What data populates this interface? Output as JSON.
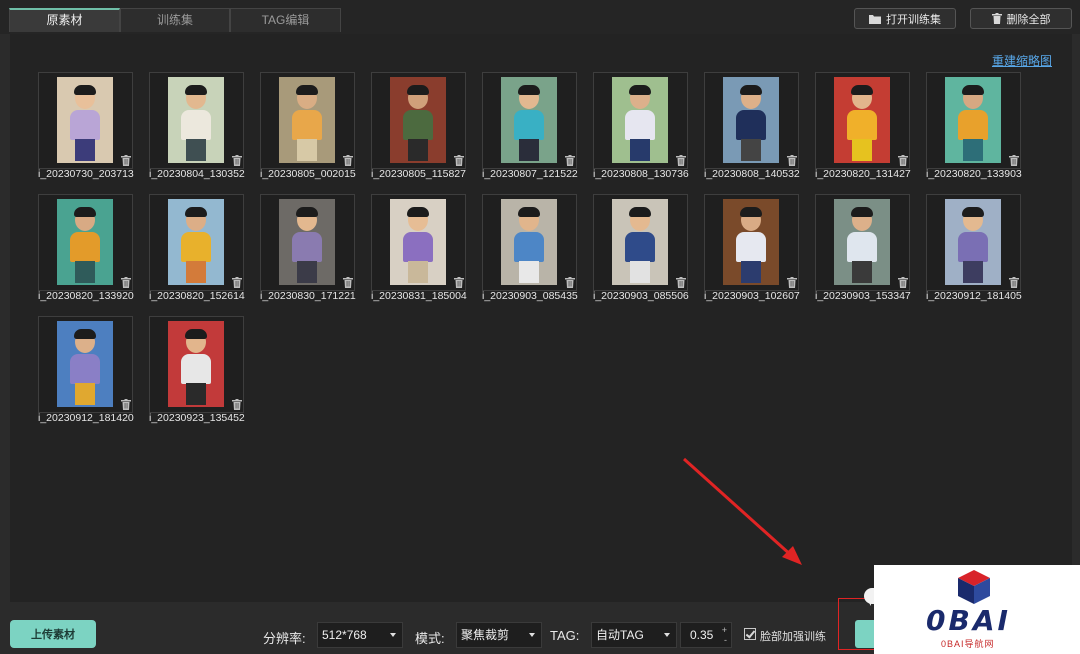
{
  "tabs": [
    {
      "label": "原素材",
      "active": true
    },
    {
      "label": "训练集",
      "active": false
    },
    {
      "label": "TAG编辑",
      "active": false
    }
  ],
  "toolbar": {
    "open_training_set": "打开训练集",
    "delete_all": "删除全部"
  },
  "rebuild_thumbnails": "重建缩略图",
  "images": [
    {
      "name": "i_20230730_203713",
      "bg": "#d9c9b0",
      "shirt": "#b9a5d6",
      "pants": "#3c3c7a",
      "skin": "#e8c09a"
    },
    {
      "name": "i_20230804_130352",
      "bg": "#c8d3b9",
      "shirt": "#ece8dd",
      "pants": "#3f4f52",
      "skin": "#e2b88f"
    },
    {
      "name": "i_20230805_002015",
      "bg": "#a89a7a",
      "shirt": "#e8a74a",
      "pants": "#d7c9a6",
      "skin": "#d9ad84"
    },
    {
      "name": "i_20230805_115827",
      "bg": "#8a3d2d",
      "shirt": "#4c6a3f",
      "pants": "#2a2a2a",
      "skin": "#d0a07a"
    },
    {
      "name": "i_20230807_121522",
      "bg": "#7aa38a",
      "shirt": "#39b0c4",
      "pants": "#2a2d3a",
      "skin": "#e2b890"
    },
    {
      "name": "i_20230808_130736",
      "bg": "#9fbf8f",
      "shirt": "#e6e6f0",
      "pants": "#273a6b",
      "skin": "#dcb08b"
    },
    {
      "name": "i_20230808_140532",
      "bg": "#7a9ab5",
      "shirt": "#1f2f5a",
      "pants": "#444",
      "skin": "#ddb089"
    },
    {
      "name": "i_20230820_131427",
      "bg": "#c43d33",
      "shirt": "#f0b02a",
      "pants": "#e6c21f",
      "skin": "#e2b58c"
    },
    {
      "name": "i_20230820_133903",
      "bg": "#5fb59f",
      "shirt": "#e8a12c",
      "pants": "#2d6e78",
      "skin": "#d6a882"
    },
    {
      "name": "i_20230820_133920",
      "bg": "#4aa391",
      "shirt": "#e39b2a",
      "pants": "#2f5b5a",
      "skin": "#d8aa84"
    },
    {
      "name": "i_20230820_152614",
      "bg": "#93b8d0",
      "shirt": "#e8b12c",
      "pants": "#d37b3a",
      "skin": "#dcae87"
    },
    {
      "name": "i_20230830_171221",
      "bg": "#6d6a66",
      "shirt": "#8a7bb0",
      "pants": "#3b3b48",
      "skin": "#e3b88f"
    },
    {
      "name": "i_20230831_185004",
      "bg": "#d8d0c4",
      "shirt": "#8b6fc0",
      "pants": "#c9b89a",
      "skin": "#e6bd95"
    },
    {
      "name": "i_20230903_085435",
      "bg": "#b9b4a8",
      "shirt": "#4d86c6",
      "pants": "#e8e8e8",
      "skin": "#e1b58c"
    },
    {
      "name": "i_20230903_085506",
      "bg": "#c9c4b8",
      "shirt": "#2f4b8a",
      "pants": "#e2e2e2",
      "skin": "#e4b990"
    },
    {
      "name": "i_20230903_102607",
      "bg": "#7a4a2a",
      "shirt": "#e6e8f0",
      "pants": "#2c3c6e",
      "skin": "#d9ab85"
    },
    {
      "name": "i_20230903_153347",
      "bg": "#7b8f86",
      "shirt": "#dfe6ee",
      "pants": "#3a3a3a",
      "skin": "#dcb08a"
    },
    {
      "name": "i_20230912_181405",
      "bg": "#9fb0c6",
      "shirt": "#7a6fb4",
      "pants": "#3d3d60",
      "skin": "#e3b990"
    },
    {
      "name": "i_20230912_181420",
      "bg": "#4d7fc0",
      "shirt": "#8a7fc6",
      "pants": "#e0a830",
      "skin": "#dcb08a"
    },
    {
      "name": "i_20230923_135452",
      "bg": "#c23a3a",
      "shirt": "#e7e7e7",
      "pants": "#2a2a2a",
      "skin": "#e2b58c"
    }
  ],
  "footer": {
    "upload_label": "上传素材",
    "resolution_label": "分辨率:",
    "resolution_value": "512*768",
    "mode_label": "模式:",
    "mode_value": "聚焦裁剪",
    "tag_label": "TAG:",
    "tag_value": "自动TAG",
    "threshold_value": "0.35",
    "face_enhance_label": "脸部加强训练",
    "face_enhance_checked": true
  },
  "watermark": {
    "logo": "0BAI",
    "sub": "0BAI导航网"
  },
  "colors": {
    "accent": "#7cd3c2",
    "link": "#58a7e8",
    "annotation": "#e02424"
  }
}
